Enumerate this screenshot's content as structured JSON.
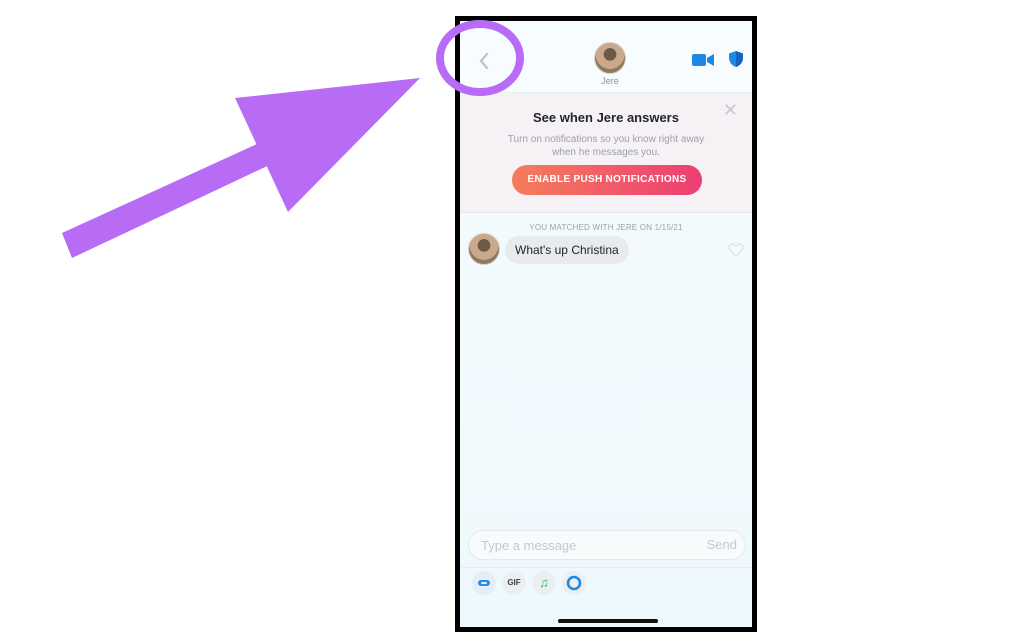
{
  "header": {
    "contact_name": "Jere",
    "back_icon": "chevron-left-icon",
    "video_icon": "video-camera-icon",
    "safety_icon": "shield-icon"
  },
  "notification_card": {
    "title": "See when Jere answers",
    "body": "Turn on notifications so you know right away when he messages you.",
    "button_label": "ENABLE PUSH NOTIFICATIONS",
    "close_glyph": "✕"
  },
  "chat": {
    "match_info": "YOU MATCHED WITH JERE ON 1/15/21",
    "messages": [
      {
        "text": "What's up Christina",
        "liked": false
      }
    ]
  },
  "composer": {
    "placeholder": "Type a message",
    "send_label": "Send"
  },
  "toolbar": {
    "gif_label": "GIF",
    "music_glyph": "♫"
  },
  "colors": {
    "accent_blue": "#1e88e5",
    "push_gradient_start": "#f47d5b",
    "push_gradient_end": "#ee3d74",
    "annotation_purple": "#b86cf5"
  }
}
